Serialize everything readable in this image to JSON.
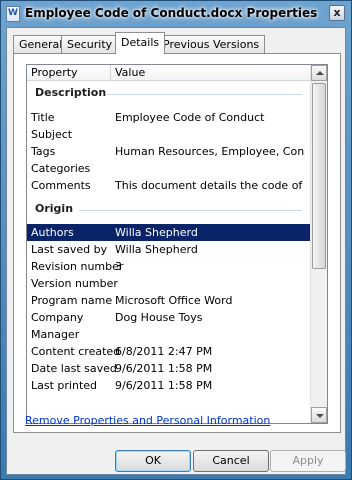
{
  "window": {
    "title": "Employee Code of Conduct.docx Properties",
    "close_glyph": "x"
  },
  "tabs": [
    {
      "label": "General",
      "active": false
    },
    {
      "label": "Security",
      "active": false
    },
    {
      "label": "Details",
      "active": true
    },
    {
      "label": "Previous Versions",
      "active": false
    }
  ],
  "list": {
    "columns": {
      "property": "Property",
      "value": "Value"
    },
    "groups": {
      "description": {
        "label": "Description",
        "rows": [
          {
            "property": "Title",
            "value": "Employee Code of Conduct"
          },
          {
            "property": "Subject",
            "value": ""
          },
          {
            "property": "Tags",
            "value": "Human Resources, Employee, Cond..."
          },
          {
            "property": "Categories",
            "value": ""
          },
          {
            "property": "Comments",
            "value": "This document details the code of c..."
          }
        ]
      },
      "origin": {
        "label": "Origin",
        "rows": [
          {
            "property": "Authors",
            "value": "Willa Shepherd",
            "selected": true
          },
          {
            "property": "Last saved by",
            "value": "Willa Shepherd"
          },
          {
            "property": "Revision number",
            "value": "3"
          },
          {
            "property": "Version number",
            "value": ""
          },
          {
            "property": "Program name",
            "value": "Microsoft Office Word"
          },
          {
            "property": "Company",
            "value": "Dog House Toys"
          },
          {
            "property": "Manager",
            "value": ""
          },
          {
            "property": "Content created",
            "value": "6/8/2011 2:47 PM"
          },
          {
            "property": "Date last saved",
            "value": "9/6/2011 1:58 PM"
          },
          {
            "property": "Last printed",
            "value": "9/6/2011 1:58 PM"
          }
        ]
      }
    }
  },
  "remove_link": "Remove Properties and Personal Information",
  "buttons": {
    "ok": "OK",
    "cancel": "Cancel",
    "apply": "Apply"
  },
  "colors": {
    "selection": "#0a246a",
    "link": "#0033cc",
    "title_bar": "#3c79ad"
  }
}
